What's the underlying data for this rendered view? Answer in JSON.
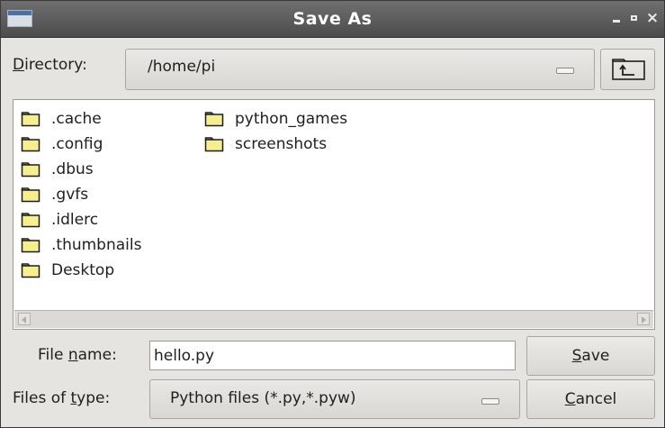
{
  "window": {
    "title": "Save As",
    "icon": "app-window-icon",
    "controls": {
      "minimize": "minimize-icon",
      "maximize": "maximize-icon",
      "close": "×"
    }
  },
  "directory": {
    "label_first": "D",
    "label_rest": "irectory:",
    "path": "/home/pi",
    "up_button_icon": "folder-up-icon"
  },
  "files": {
    "column1": [
      ".cache",
      ".config",
      ".dbus",
      ".gvfs",
      ".idlerc",
      ".thumbnails",
      "Desktop"
    ],
    "column2": [
      "python_games",
      "screenshots"
    ],
    "item_icon": "folder-icon"
  },
  "filename": {
    "label_pre": "File ",
    "label_u": "n",
    "label_post": "ame:",
    "value": "hello.py"
  },
  "filetype": {
    "label_pre": "Files of ",
    "label_u": "t",
    "label_post": "ype:",
    "value": "Python files (*.py,*.pyw)"
  },
  "buttons": {
    "save_u": "S",
    "save_rest": "ave",
    "cancel_u": "C",
    "cancel_rest": "ancel"
  },
  "colors": {
    "titlebar": "#5a5a5a",
    "dialog_bg": "#e6e4e1",
    "folder_fill": "#f5ef8f"
  }
}
